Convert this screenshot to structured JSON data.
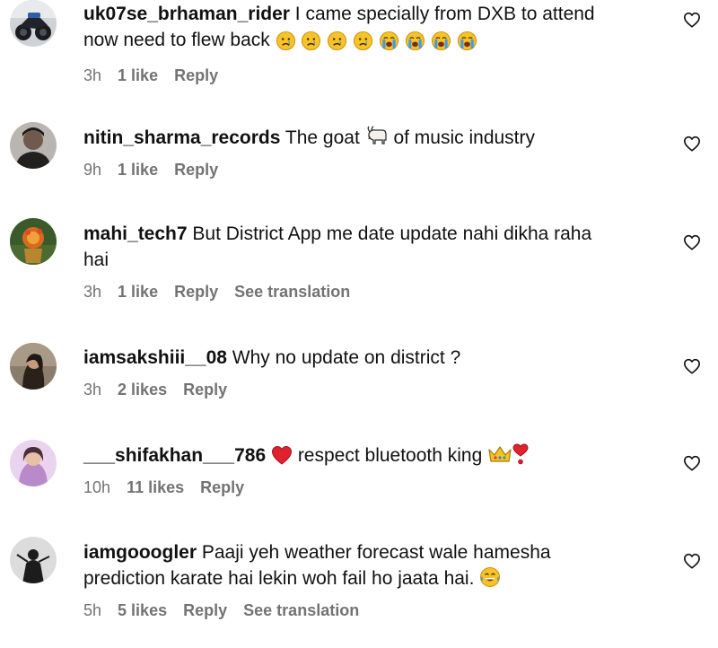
{
  "comments": [
    {
      "username": "uk07se_brhaman_rider",
      "text_line1": " I came specially from DXB to attend",
      "text_line2": "now need to flew back ",
      "emojis": [
        "sad-face-icon",
        "sad-face-icon",
        "sad-face-icon",
        "sad-face-icon",
        "crying-face-icon",
        "crying-face-icon",
        "crying-face-icon",
        "crying-face-icon"
      ],
      "time": "3h",
      "likes": "1 like",
      "reply": "Reply"
    },
    {
      "username": "nitin_sharma_records",
      "text_before": " The goat ",
      "text_after": " of music industry",
      "time": "9h",
      "likes": "1 like",
      "reply": "Reply"
    },
    {
      "username": "mahi_tech7",
      "text_line1": " But District App me date update nahi dikha raha",
      "text_line2": "hai",
      "time": "3h",
      "likes": "1 like",
      "reply": "Reply",
      "translation": "See translation"
    },
    {
      "username": "iamsakshiii__08",
      "text": " Why no update on district ?",
      "time": "3h",
      "likes": "2 likes",
      "reply": "Reply"
    },
    {
      "username": "___shifakhan___786",
      "text_middle": " respect bluetooth king ",
      "time": "10h",
      "likes": "11 likes",
      "reply": "Reply"
    },
    {
      "username": "iamgooogler",
      "text_line1": " Paaji yeh weather forecast wale hamesha",
      "text_line2": "prediction karate hai lekin woh fail ho jaata hai. ",
      "time": "5h",
      "likes": "5 likes",
      "reply": "Reply",
      "translation": "See translation"
    }
  ],
  "colors": {
    "text": "#111111",
    "meta": "#737373",
    "heart_red": "#e0222f",
    "emoji_yellow": "#f7c325",
    "tear_blue": "#3d9be9"
  }
}
